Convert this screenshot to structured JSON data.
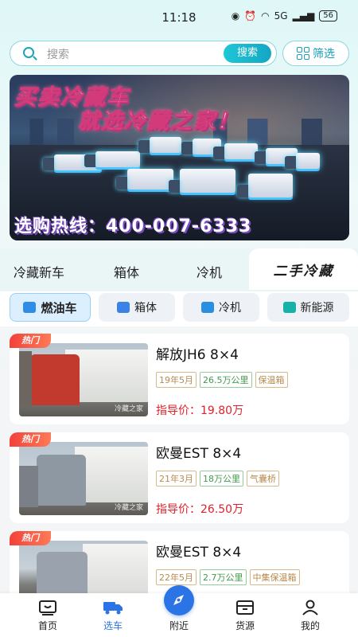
{
  "status_bar": {
    "time": "11:18",
    "battery": "56",
    "signal": "5G"
  },
  "search": {
    "placeholder": "搜索",
    "button_label": "搜索",
    "filter_label": "筛选"
  },
  "banner": {
    "title_line1": "买卖冷藏车",
    "title_line2": "就选冷藏之家！",
    "hotline": "选购热线：400-007-6333"
  },
  "category_tabs": [
    {
      "label": "冷藏新车",
      "active": false
    },
    {
      "label": "箱体",
      "active": false
    },
    {
      "label": "冷机",
      "active": false
    },
    {
      "label": "二手冷藏",
      "active": true
    }
  ],
  "sub_tabs": [
    {
      "label": "燃油车",
      "active": true,
      "color": "#2f8de8"
    },
    {
      "label": "箱体",
      "active": false,
      "color": "#3b82e6"
    },
    {
      "label": "冷机",
      "active": false,
      "color": "#2a8fe0"
    },
    {
      "label": "新能源",
      "active": false,
      "color": "#16b2a8"
    }
  ],
  "listings": [
    {
      "badge": "热门",
      "title": "解放JH6 8×4",
      "tags": [
        "19年5月",
        "26.5万公里",
        "保温箱"
      ],
      "price_label": "指导价：",
      "price": "19.80万",
      "watermark": "冷藏之家",
      "cab_color": "#c23a2e"
    },
    {
      "badge": "热门",
      "title": "欧曼EST 8×4",
      "tags": [
        "21年3月",
        "18万公里",
        "气囊桥"
      ],
      "price_label": "指导价：",
      "price": "26.50万",
      "watermark": "冷藏之家",
      "cab_color": "#8e98a2"
    },
    {
      "badge": "热门",
      "title": "欧曼EST 8×4",
      "tags": [
        "22年5月",
        "2.7万公里",
        "中集保温箱"
      ],
      "price_label": "",
      "price": "",
      "watermark": "",
      "cab_color": "#9aa3ad"
    }
  ],
  "bottom_nav": [
    {
      "label": "首页",
      "icon": "home-icon",
      "active": false
    },
    {
      "label": "选车",
      "icon": "truck-icon",
      "active": true
    },
    {
      "label": "附近",
      "icon": "compass-icon",
      "active": false
    },
    {
      "label": "货源",
      "icon": "box-icon",
      "active": false
    },
    {
      "label": "我的",
      "icon": "user-icon",
      "active": false
    }
  ],
  "colors": {
    "accent": "#15a0ba",
    "price": "#e0202a",
    "nav_active": "#2b74e6"
  }
}
